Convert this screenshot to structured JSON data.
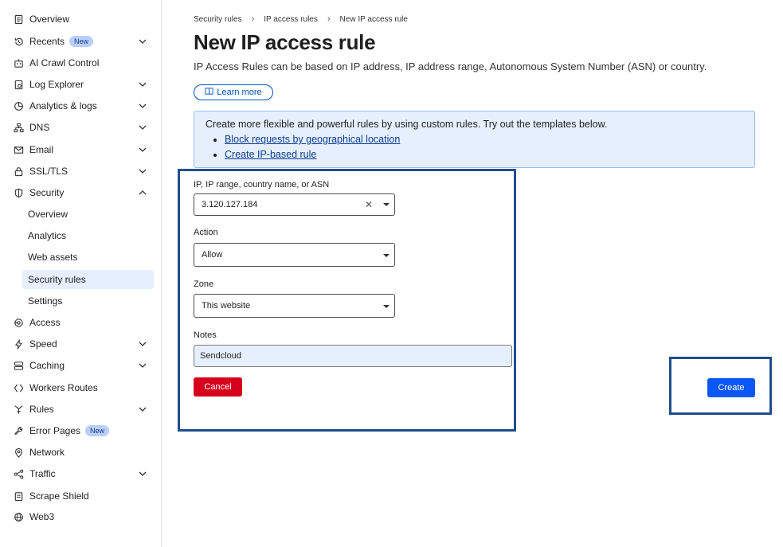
{
  "sidebar": {
    "items": [
      {
        "label": "Overview",
        "icon": "document-icon"
      },
      {
        "label": "Recents",
        "icon": "history-icon",
        "badge": "New",
        "chevron": "down"
      },
      {
        "label": "AI Crawl Control",
        "icon": "robot-icon"
      },
      {
        "label": "Log Explorer",
        "icon": "log-icon",
        "chevron": "down"
      },
      {
        "label": "Analytics & logs",
        "icon": "pie-chart-icon",
        "chevron": "down"
      },
      {
        "label": "DNS",
        "icon": "network-tree-icon",
        "chevron": "down"
      },
      {
        "label": "Email",
        "icon": "email-icon",
        "chevron": "down"
      },
      {
        "label": "SSL/TLS",
        "icon": "lock-icon",
        "chevron": "down"
      },
      {
        "label": "Security",
        "icon": "shield-icon",
        "chevron": "up"
      },
      {
        "label": "Overview"
      },
      {
        "label": "Analytics"
      },
      {
        "label": "Web assets"
      },
      {
        "label": "Security rules"
      },
      {
        "label": "Settings"
      },
      {
        "label": "Access",
        "icon": "access-icon"
      },
      {
        "label": "Speed",
        "icon": "lightning-icon",
        "chevron": "down"
      },
      {
        "label": "Caching",
        "icon": "storage-icon",
        "chevron": "down"
      },
      {
        "label": "Workers Routes",
        "icon": "workers-icon"
      },
      {
        "label": "Rules",
        "icon": "rules-icon",
        "chevron": "down"
      },
      {
        "label": "Error Pages",
        "icon": "wrench-icon",
        "badge": "New"
      },
      {
        "label": "Network",
        "icon": "location-pin-icon"
      },
      {
        "label": "Traffic",
        "icon": "traffic-icon",
        "chevron": "down"
      },
      {
        "label": "Scrape Shield",
        "icon": "clipboard-icon"
      },
      {
        "label": "Web3",
        "icon": "globe-icon"
      }
    ]
  },
  "breadcrumb": [
    "Security rules",
    "IP access rules",
    "New IP access rule"
  ],
  "page": {
    "title": "New IP access rule",
    "description": "IP Access Rules can be based on IP address, IP address range, Autonomous System Number (ASN) or country.",
    "learn_more": "Learn more"
  },
  "info": {
    "text": "Create more flexible and powerful rules by using custom rules. Try out the templates below.",
    "links": [
      "Block requests by geographical location",
      "Create IP-based rule"
    ]
  },
  "form": {
    "ip_label": "IP, IP range, country name, or ASN",
    "ip_value": "3.120.127.184",
    "action_label": "Action",
    "action_value": "Allow",
    "zone_label": "Zone",
    "zone_value": "This website",
    "notes_label": "Notes",
    "notes_value": "Sendcloud",
    "cancel": "Cancel",
    "create": "Create"
  },
  "colors": {
    "accent": "#0b57f5",
    "danger": "#d6001c",
    "highlight_border": "#1f4e8c",
    "info_bg": "#e6effd"
  }
}
